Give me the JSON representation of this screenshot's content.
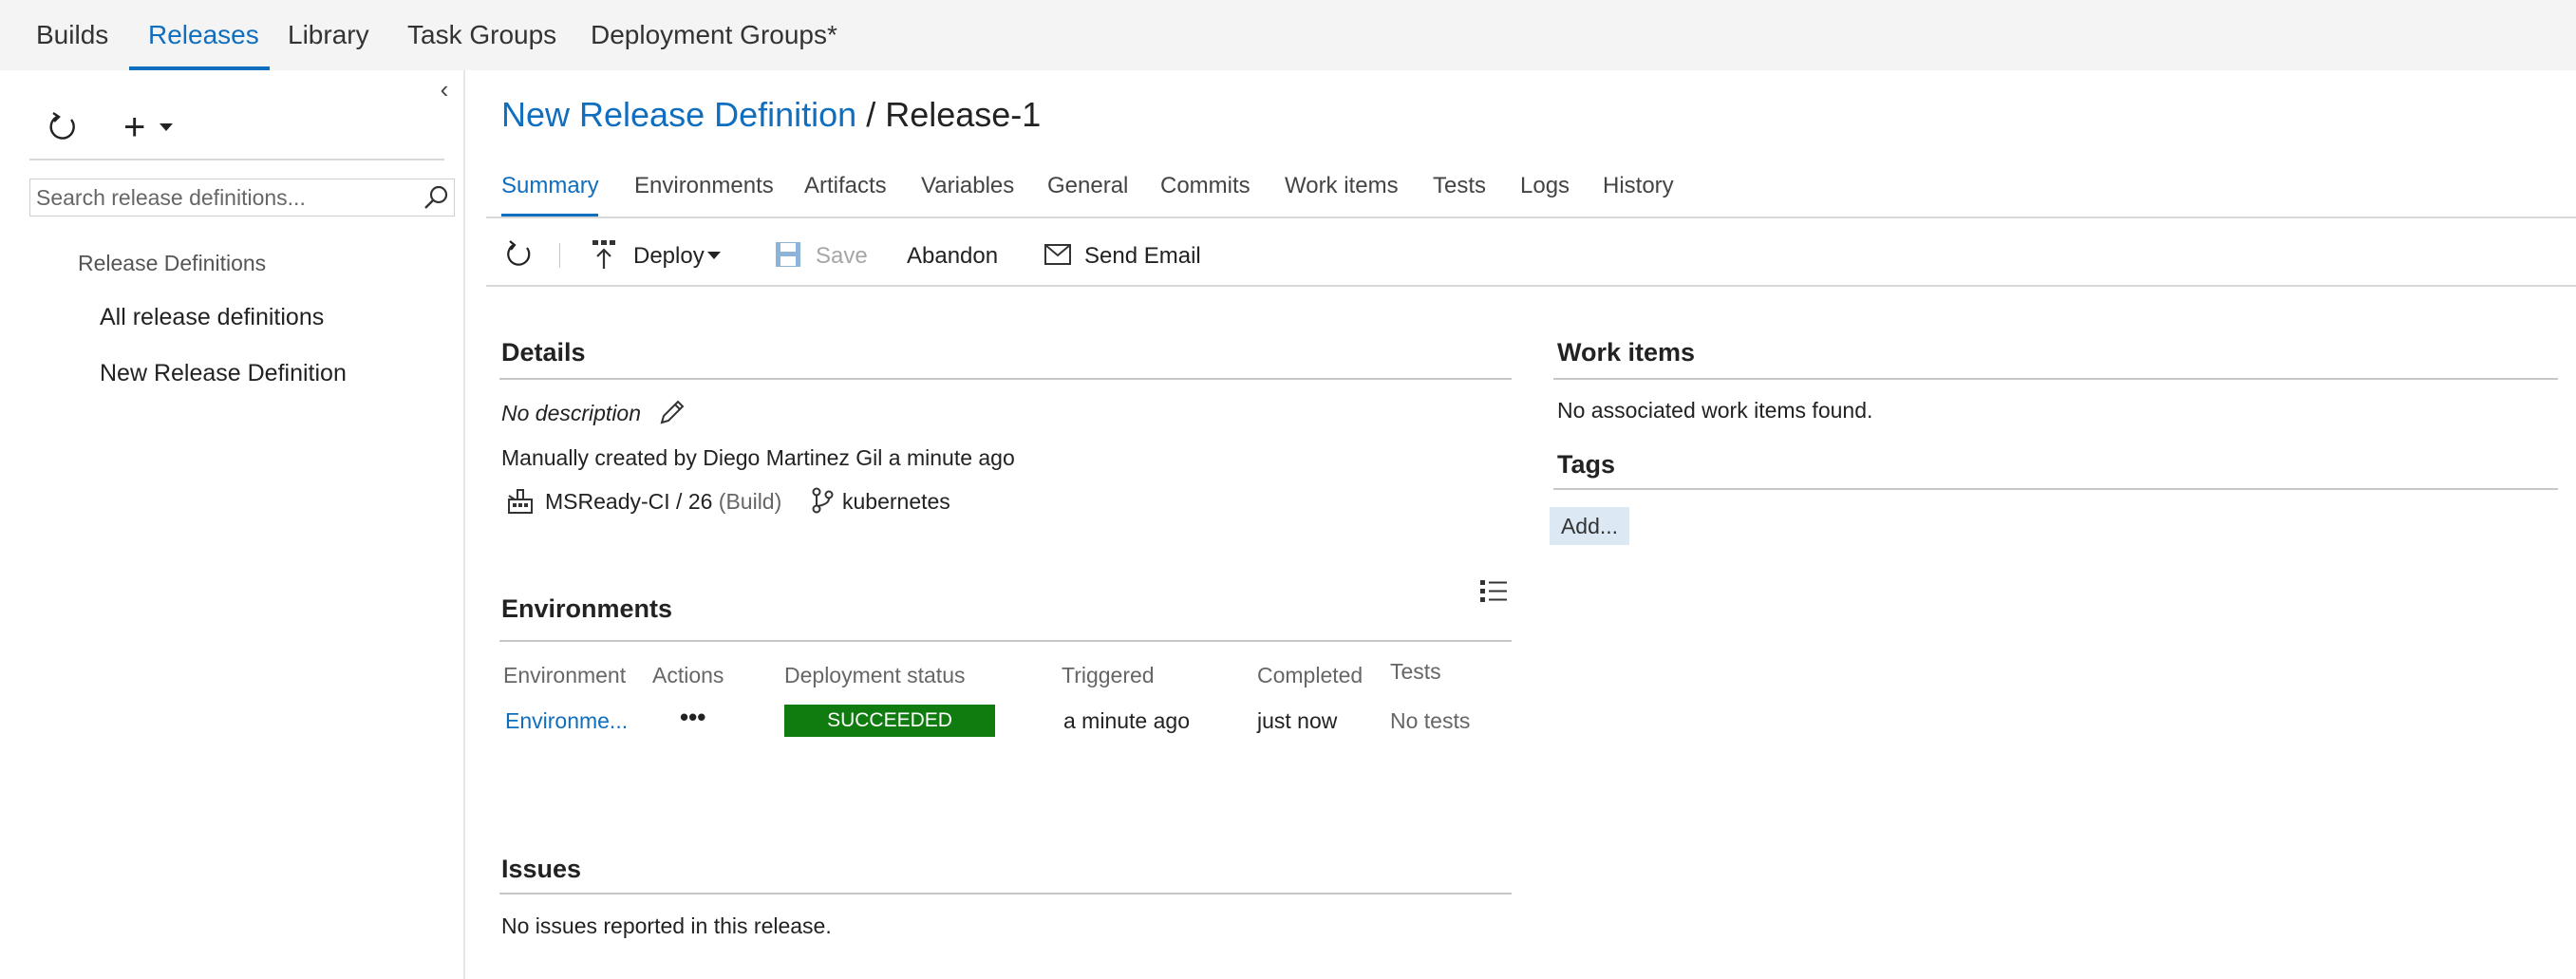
{
  "topnav": {
    "items": [
      {
        "label": "Builds"
      },
      {
        "label": "Releases"
      },
      {
        "label": "Library"
      },
      {
        "label": "Task Groups"
      },
      {
        "label": "Deployment Groups*"
      }
    ],
    "active": "Releases"
  },
  "sidebar": {
    "search_placeholder": "Search release definitions...",
    "heading": "Release Definitions",
    "items": [
      {
        "label": "All release definitions"
      },
      {
        "label": "New Release Definition"
      }
    ]
  },
  "breadcrumb": {
    "definition": "New Release Definition",
    "separator": "/",
    "release": "Release-1"
  },
  "tabs": [
    {
      "label": "Summary"
    },
    {
      "label": "Environments"
    },
    {
      "label": "Artifacts"
    },
    {
      "label": "Variables"
    },
    {
      "label": "General"
    },
    {
      "label": "Commits"
    },
    {
      "label": "Work items"
    },
    {
      "label": "Tests"
    },
    {
      "label": "Logs"
    },
    {
      "label": "History"
    }
  ],
  "toolbar": {
    "deploy": "Deploy",
    "save": "Save",
    "abandon": "Abandon",
    "send_email": "Send Email"
  },
  "details": {
    "title": "Details",
    "description": "No description",
    "created": "Manually created by Diego Martinez Gil a minute ago",
    "artifact": "MSReady-CI / 26",
    "artifact_type": "(Build)",
    "branch": "kubernetes"
  },
  "environments": {
    "title": "Environments",
    "columns": [
      "Environment",
      "Actions",
      "Deployment status",
      "Triggered",
      "Completed",
      "Tests"
    ],
    "rows": [
      {
        "environment": "Environme...",
        "actions": "•••",
        "status": "SUCCEEDED",
        "triggered": "a minute ago",
        "completed": "just now",
        "tests": "No tests"
      }
    ]
  },
  "issues": {
    "title": "Issues",
    "text": "No issues reported in this release."
  },
  "work_items": {
    "title": "Work items",
    "text": "No associated work items found."
  },
  "tags": {
    "title": "Tags",
    "add": "Add..."
  },
  "colors": {
    "accent": "#106ebe",
    "success": "#107c10",
    "tag_bg": "#dce9f5"
  },
  "icons": [
    "refresh-icon",
    "plus-icon",
    "chevron-left-icon",
    "search-icon",
    "deploy-icon",
    "save-icon",
    "mail-icon",
    "pencil-icon",
    "build-icon",
    "branch-icon",
    "list-view-icon",
    "more-actions-icon"
  ]
}
